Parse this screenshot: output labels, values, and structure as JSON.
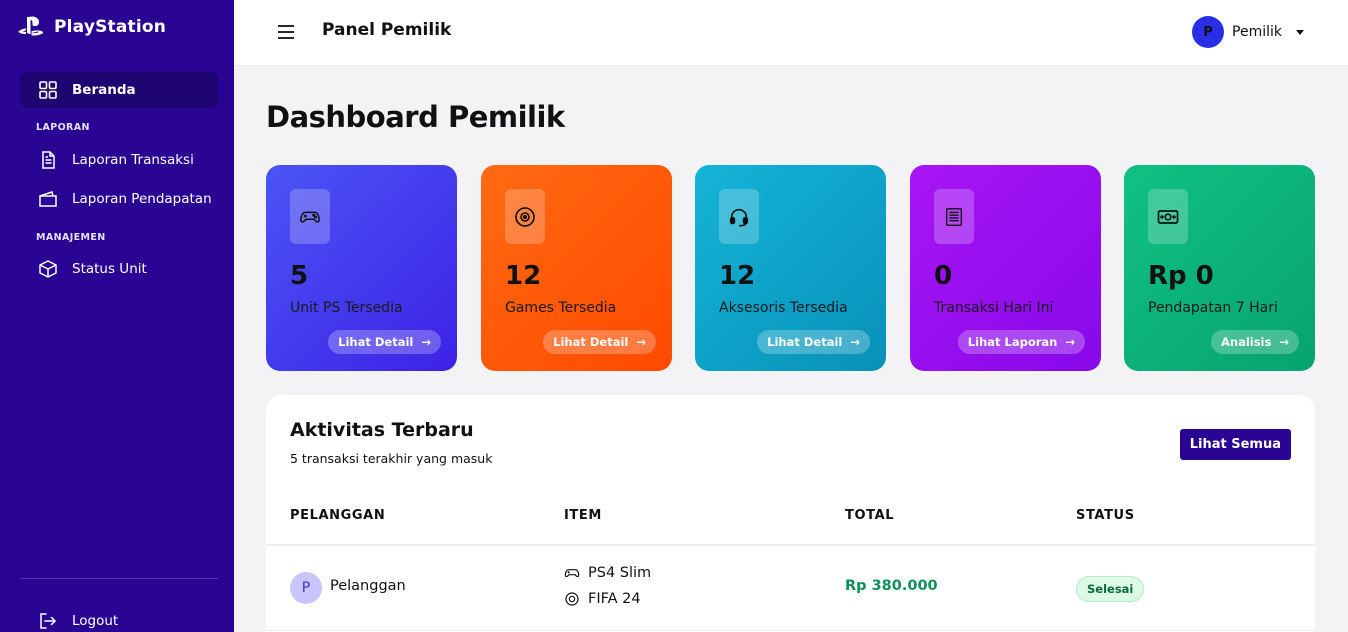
{
  "brand": {
    "name": "PlayStation"
  },
  "sidebar": {
    "items": [
      {
        "label": "Beranda",
        "icon": "dashboard-grid-icon",
        "active": true
      },
      {
        "label": "Laporan Transaksi",
        "icon": "document-icon"
      },
      {
        "label": "Laporan Pendapatan",
        "icon": "wallet-icon"
      },
      {
        "label": "Status Unit",
        "icon": "box-icon"
      }
    ],
    "sections": {
      "laporan": "LAPORAN",
      "manajemen": "MANAJEMEN"
    },
    "logout": "Logout"
  },
  "header": {
    "title": "Panel Pemilik",
    "user": {
      "initial": "P",
      "name": "Pemilik"
    }
  },
  "page": {
    "title": "Dashboard Pemilik"
  },
  "stats": [
    {
      "value": "5",
      "label": "Unit PS Tersedia",
      "action": "Lihat Detail",
      "icon": "gamepad-icon"
    },
    {
      "value": "12",
      "label": "Games Tersedia",
      "action": "Lihat Detail",
      "icon": "disc-icon"
    },
    {
      "value": "12",
      "label": "Aksesoris Tersedia",
      "action": "Lihat Detail",
      "icon": "headset-icon"
    },
    {
      "value": "0",
      "label": "Transaksi Hari Ini",
      "action": "Lihat Laporan",
      "icon": "receipt-icon"
    },
    {
      "value": "Rp 0",
      "label": "Pendapatan 7 Hari",
      "action": "Analisis",
      "icon": "money-icon"
    }
  ],
  "activity": {
    "title": "Aktivitas Terbaru",
    "subtitle": "5 transaksi terakhir yang masuk",
    "see_all": "Lihat Semua",
    "columns": [
      "PELANGGAN",
      "ITEM",
      "TOTAL",
      "STATUS"
    ],
    "rows": [
      {
        "initial": "P",
        "customer": "Pelanggan",
        "items": [
          {
            "name": "PS4 Slim",
            "icon": "gamepad-icon"
          },
          {
            "name": "FIFA 24",
            "icon": "disc-icon"
          }
        ],
        "total": "Rp 380.000",
        "status": "Selesai"
      }
    ]
  },
  "colors": {
    "sidebar": "#2a0594",
    "card_blue": "#4148f0",
    "card_orange": "#ff5a0a",
    "card_cyan": "#0ea4c8",
    "card_purple": "#970ff0",
    "card_green": "#0bb27a",
    "total_green": "#109158"
  }
}
